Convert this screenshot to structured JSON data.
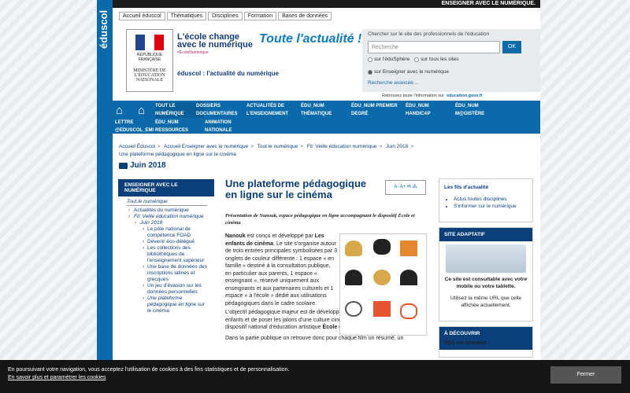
{
  "site": {
    "logo": "éduscol",
    "top_label": "ENSEIGNER AVEC LE NUMÉRIQUE."
  },
  "topnav": [
    "Accueil éduscol",
    "Thématiques",
    "Disciplines",
    "Formation",
    "Bases de données"
  ],
  "header": {
    "ministere": "MINISTÈRE DE L'ÉDUCATION NATIONALE",
    "republique": "RÉPUBLIQUE FRANÇAISE",
    "ecole": "L'école change avec le numérique",
    "hashtag": "#EcoleNumerique",
    "toute": "Toute l'actualité !",
    "actu": "éduscol : l'actualité du numérique"
  },
  "search": {
    "label": "Chercher sur le site des professionnels de l'éducation",
    "placeholder": "Recherche",
    "ok": "OK",
    "r1": "sur l'éduSphère",
    "r2": "sur tous les sites",
    "r3": "sur Enseigner avec le numérique",
    "adv": "Recherche avancée…"
  },
  "retrouvez": {
    "text": "Retrouvez toute l'information sur",
    "link": "education.gouv.fr"
  },
  "nav": {
    "items": [
      "TOUT LE NUMÉRIQUE",
      "DOSSIERS DOCUMENTAIRES",
      "ACTUALITÉS DE L'ENSEIGNEMENT",
      "ÉDU_NUM THÉMATIQUE",
      "ÉDU_NUM PREMIER DEGRÉ",
      "ÉDU_NUM HANDICAP",
      "ÉDU_NUM M@GISTÈRE",
      "LETTRE @EDUSCOL_EMI",
      "ÉDU_NUM RESSOURCES",
      "ANIMATION NATIONALE"
    ]
  },
  "breadcrumb": [
    "Accueil Éduscol",
    "Accueil Enseigner avec le numérique",
    "Tout le numérique",
    "Fil: Veille éducation numérique",
    "Juin 2018"
  ],
  "breadcrumb_last": "Une plateforme pédagogique en ligne sur le cinéma",
  "section_title": "Juin 2018",
  "left": {
    "head": "ENSEIGNER AVEC LE NUMÉRIQUE",
    "sub": "Tout le numérique",
    "items": [
      "Actualités du numérique",
      "Fil: Veille éducation numérique",
      "Juin 2018",
      "Le pôle national de compétence FOAD",
      "Devenir éco-délégué",
      "Les collections des bibliothèques de l'enseignement supérieur",
      "Une base de données des inscriptions latines et grecques",
      "Un jeu d'évasion sur les données personnelles",
      "Une plateforme pédagogique en ligne sur le cinéma"
    ]
  },
  "article": {
    "title": "Une plateforme pédagogique en ligne sur le cinéma",
    "tools": "A- A+ ✉ ⁂",
    "chapeau": "Présentation de Nanouk, espace pédagogique en ligne accompagnant le dispositif École et cinéma",
    "p1a": "Nanouk",
    "p1b": " est conçu et développé par ",
    "p1c": "Les enfants de cinéma",
    "p1d": ". Le site s'organise autour de trois entrées principales symbolisées par 3 onglets de couleur différente : 1 espace « en famille » destiné à la consultation publique, en particulier aux parents, 1 espace « enseignant », réservé uniquement aux enseignants et aux partenaires culturels et 1 espace « à l'école » dédié aux utilisations pédagogiques dans le cadre scolaire.",
    "p2a": "L'objectif pédagogique majeur est de développer la « sensibilité artistique des enfants et de poser les jalons d'une culture cinématographique » dans le cadre du dispositif national d'éducation artistique ",
    "p2b": "École et cinéma",
    "p2c": ".",
    "p3": "Dans la partie publique on retrouve donc pour chaque film un résumé, un"
  },
  "right": {
    "fils": "Les fils d'actualité",
    "fil1": "Actus toutes disciplines",
    "fil2": "S'informer sur le numérique",
    "adaptatif": "SITE ADAPTATIF",
    "adapt_b": "Ce site est consultable avec votre mobile ou votre tablette.",
    "adapt_t": "Utilisez la même URL que celle affichée actuellement.",
    "decouvrir": "À DÉCOUVRIR",
    "rss": "RSS sur Netvibes :"
  },
  "cookie": {
    "text": "En poursuivant votre navigation, vous acceptez l'utilisation de cookies à des fins statistiques et de personnalisation.",
    "link": "En savoir plus et paramétrer les cookies",
    "btn": "Fermer"
  },
  "colors": {
    "brand": "#0b6aa9",
    "dark": "#0b3f7a"
  }
}
